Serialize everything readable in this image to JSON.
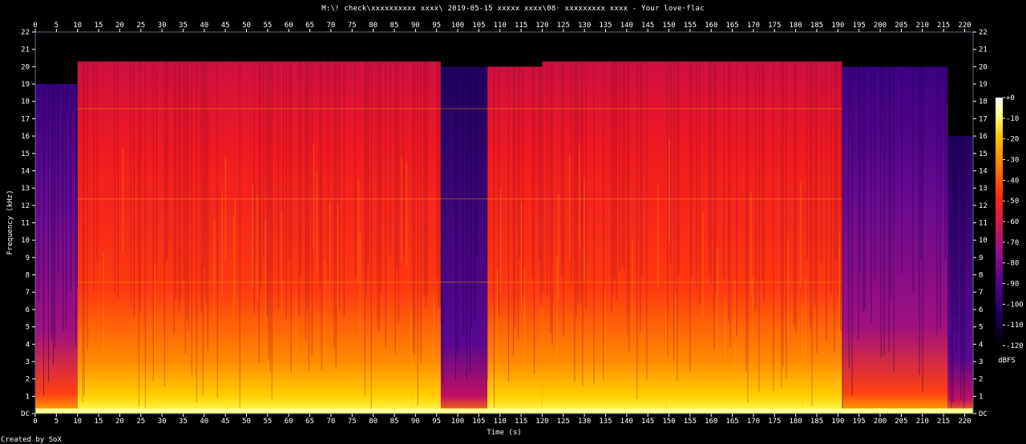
{
  "title": "M:\\! check\\xxxxxxxxxx xxxx\\ 2019-05-15  xxxxx xxxx\\08· xxxxxxxxx xxxx - Your love·flac",
  "credit": "Created by SoX",
  "chart_data": {
    "type": "heatmap",
    "title": "M:\\! check\\xxxxxxxxxx xxxx\\ 2019-05-15  xxxxx xxxx\\08· xxxxxxxxx xxxx - Your love·flac",
    "xlabel": "Time (s)",
    "ylabel": "Frequency (kHz)",
    "colorbar_label": "dBFS",
    "xlim": [
      0,
      222
    ],
    "ylim": [
      0,
      22
    ],
    "x_ticks": [
      0,
      5,
      10,
      15,
      20,
      25,
      30,
      35,
      40,
      45,
      50,
      55,
      60,
      65,
      70,
      75,
      80,
      85,
      90,
      95,
      100,
      105,
      110,
      115,
      120,
      125,
      130,
      135,
      140,
      145,
      150,
      155,
      160,
      165,
      170,
      175,
      180,
      185,
      190,
      195,
      200,
      205,
      210,
      215,
      220
    ],
    "y_ticks": [
      "DC",
      "1",
      "2",
      "3",
      "4",
      "5",
      "6",
      "7",
      "8",
      "9",
      "10",
      "11",
      "12",
      "13",
      "14",
      "15",
      "16",
      "17",
      "18",
      "19",
      "20",
      "21",
      "22"
    ],
    "colorbar_ticks": [
      "+0",
      "-10",
      "-20",
      "-30",
      "-40",
      "-50",
      "-60",
      "-70",
      "-80",
      "-90",
      "-100",
      "-110",
      "-120"
    ],
    "colormap": [
      "#000000",
      "#1a0055",
      "#55008c",
      "#9a0d8c",
      "#d8164a",
      "#ff2a0f",
      "#ff7a00",
      "#ffc000",
      "#ffff80",
      "#ffffff"
    ],
    "segments": [
      {
        "t_start": 0,
        "t_end": 10,
        "cutoff_khz": 19,
        "level": "medium"
      },
      {
        "t_start": 10,
        "t_end": 96,
        "cutoff_khz": 20.3,
        "level": "high"
      },
      {
        "t_start": 96,
        "t_end": 107,
        "cutoff_khz": 20,
        "level": "low"
      },
      {
        "t_start": 107,
        "t_end": 120,
        "cutoff_khz": 20,
        "level": "high"
      },
      {
        "t_start": 120,
        "t_end": 191,
        "cutoff_khz": 20.3,
        "level": "high"
      },
      {
        "t_start": 191,
        "t_end": 216,
        "cutoff_khz": 20,
        "level": "medium"
      },
      {
        "t_start": 216,
        "t_end": 222,
        "cutoff_khz": 16,
        "level": "low"
      }
    ]
  }
}
